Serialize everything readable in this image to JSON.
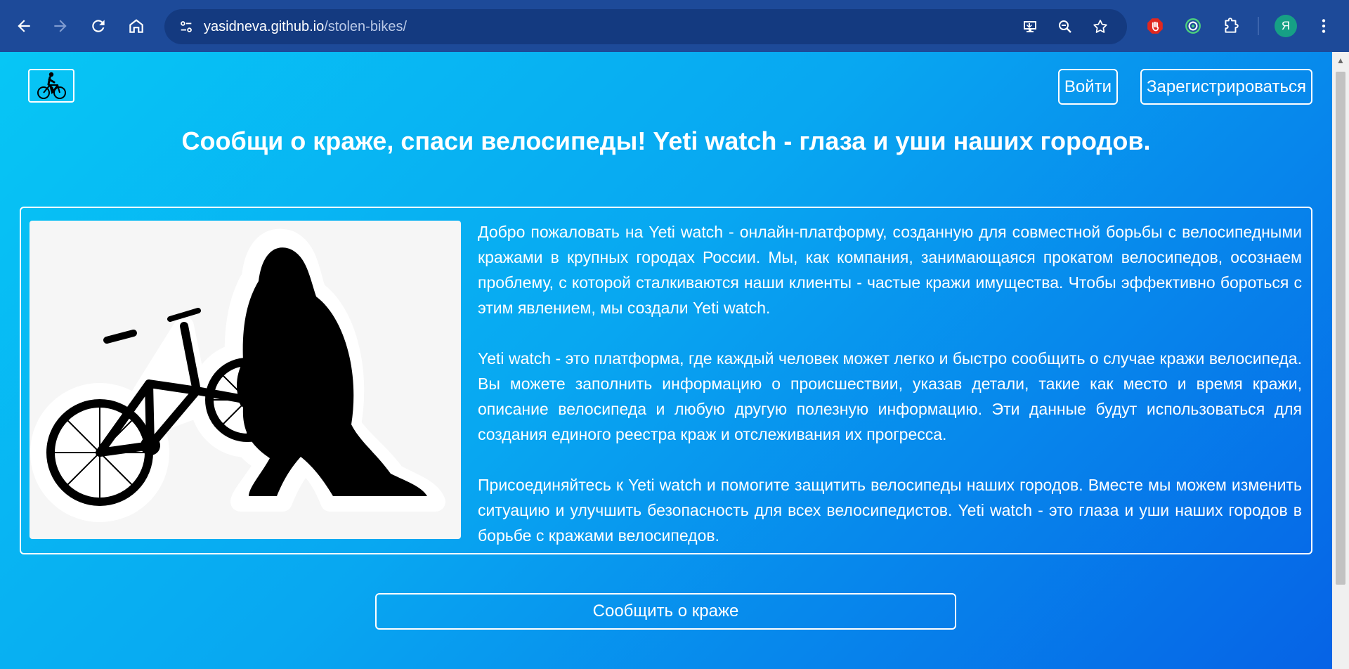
{
  "browser": {
    "url_host": "yasidneva.github.io",
    "url_path": "/stolen-bikes/",
    "profile_initial": "Я"
  },
  "header": {
    "login_label": "Войти",
    "register_label": "Зарегистрироваться"
  },
  "headline": "Сообщи о краже, спаси велосипеды! Yeti watch - глаза и уши наших городов.",
  "intro": {
    "paragraphs": [
      "Добро пожаловать на Yeti watch - онлайн-платформу, созданную для совместной борьбы с велосипедными кражами в крупных городах России. Мы, как компания, занимающаяся прокатом велосипедов, осознаем проблему, с которой сталкиваются наши клиенты - частые кражи имущества. Чтобы эффективно бороться с этим явлением, мы создали Yeti watch.",
      "Yeti watch - это платформа, где каждый человек может легко и быстро сообщить о случае кражи велосипеда. Вы можете заполнить информацию о происшествии, указав детали, такие как место и время кражи, описание велосипеда и любую другую полезную информацию. Эти данные будут использоваться для создания единого реестра краж и отслеживания их прогресса.",
      "Присоединяйтесь к Yeti watch и помогите защитить велосипеды наших городов. Вместе мы можем изменить ситуацию и улучшить безопасность для всех велосипедистов. Yeti watch - это глаза и уши наших городов в борьбе с кражами велосипедов."
    ]
  },
  "cta": {
    "report_label": "Сообщить о краже"
  },
  "icons": {
    "back": "arrow-left-icon",
    "forward": "arrow-right-icon",
    "reload": "reload-icon",
    "home": "home-icon",
    "site_info": "tune-icon",
    "install": "install-app-icon",
    "zoom": "zoom-icon",
    "bookmark": "star-icon",
    "ext_adblock": "stop-hand-icon",
    "ext_target": "target-icon",
    "extensions": "puzzle-icon",
    "menu": "kebab-menu-icon",
    "logo": "cyclist-logo-icon"
  },
  "colors": {
    "chrome_bg": "#1d4a99",
    "page_gradient_start": "#07c6f5",
    "page_gradient_end": "#0663e6",
    "text": "#ffffff"
  }
}
